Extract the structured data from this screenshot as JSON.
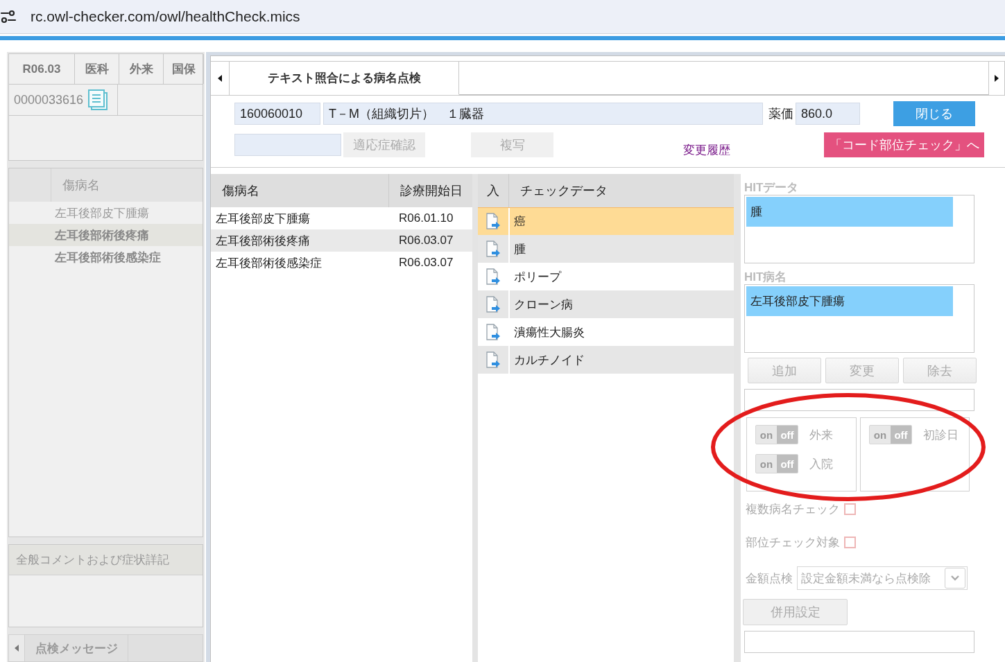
{
  "address_bar": {
    "url": "rc.owl-checker.com/owl/healthCheck.mics"
  },
  "left_panel": {
    "header_cells": [
      "R06.03",
      "医科",
      "外来",
      "国保"
    ],
    "patient_id": "0000033616",
    "disease_list": {
      "column_2": "傷病名",
      "rows": [
        {
          "name": "左耳後部皮下腫瘍",
          "selected": false,
          "emphasized": false
        },
        {
          "name": "左耳後部術後疼痛",
          "selected": true,
          "emphasized": true
        },
        {
          "name": "左耳後部術後感染症",
          "selected": false,
          "emphasized": true
        }
      ]
    },
    "comment_section": {
      "title": "全般コメントおよび症状詳記"
    },
    "bottom_tabs": [
      {
        "label": "点検メッセージ",
        "selected": true
      }
    ]
  },
  "check_window": {
    "tabs": [
      {
        "label": "テキスト照合による病名点検",
        "selected": true
      }
    ],
    "code_field": {
      "value": "160060010"
    },
    "name_field": {
      "value": "T－M（組織切片）　１臓器"
    },
    "price_label": "薬価",
    "price_field": {
      "value": "860.0"
    },
    "close_button": {
      "label": "閉じる"
    },
    "indication_button": {
      "label": "適応症確認",
      "disabled": true
    },
    "copy_button": {
      "label": "複写",
      "disabled": true
    },
    "history_link": "変更履歴",
    "code_site_button": {
      "label": "「コード部位チェック」へ"
    },
    "disease_table": {
      "columns": [
        "傷病名",
        "診療開始日"
      ],
      "rows": [
        {
          "name": "左耳後部皮下腫瘍",
          "start_date": "R06.01.10"
        },
        {
          "name": "左耳後部術後疼痛",
          "start_date": "R06.03.07"
        },
        {
          "name": "左耳後部術後感染症",
          "start_date": "R06.03.07"
        }
      ]
    },
    "check_data": {
      "columns": [
        "入",
        "チェックデータ"
      ],
      "rows": [
        {
          "text": "癌",
          "selected": true
        },
        {
          "text": "腫",
          "selected": false
        },
        {
          "text": "ポリープ",
          "selected": false
        },
        {
          "text": "クローン病",
          "selected": false
        },
        {
          "text": "潰瘍性大腸炎",
          "selected": false
        },
        {
          "text": "カルチノイド",
          "selected": false
        }
      ]
    },
    "hit_data": {
      "label": "HITデータ",
      "items": [
        {
          "text": "腫",
          "selected": true
        }
      ]
    },
    "hit_diseases": {
      "label": "HIT病名",
      "items": [
        {
          "text": "左耳後部皮下腫瘍",
          "selected": true
        }
      ]
    },
    "action_buttons": [
      {
        "label": "追加",
        "disabled": true
      },
      {
        "label": "変更",
        "disabled": true
      },
      {
        "label": "除去",
        "disabled": true
      }
    ],
    "toggle_groups": [
      {
        "toggles": [
          {
            "label": "外来",
            "on_text": "on",
            "off_text": "off",
            "on": false
          },
          {
            "label": "入院",
            "on_text": "on",
            "off_text": "off",
            "on": false
          }
        ]
      },
      {
        "toggles": [
          {
            "label": "初診日",
            "on_text": "on",
            "off_text": "off",
            "on": false
          }
        ]
      }
    ],
    "checkboxes": [
      {
        "label": "複数病名チェック",
        "checked": false
      },
      {
        "label": "部位チェック対象",
        "checked": false
      }
    ],
    "amount_check": {
      "label": "金額点検",
      "value": "設定金額未満なら点検除"
    },
    "combined_button": {
      "label": "併用設定",
      "disabled": true
    }
  },
  "annotations": [
    {
      "kind": "ellipse"
    }
  ]
}
